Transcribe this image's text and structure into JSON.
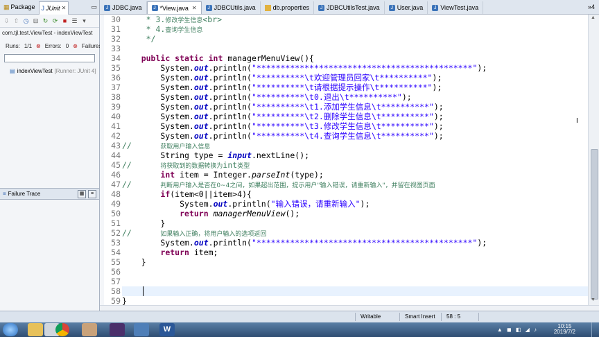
{
  "left_panel": {
    "tabs": [
      {
        "label": "Package",
        "icon": "package-icon"
      },
      {
        "label": "JUnit",
        "icon": "junit-icon"
      }
    ],
    "toolbar_icons": [
      "down-arrow-icon",
      "up-arrow-icon",
      "history-icon",
      "lock-icon",
      "rerun-icon",
      "rerun-failed-icon",
      "stop-icon",
      "layout-icon",
      "chevron-down-icon"
    ],
    "run_line": "com.tjl.test.ViewTest - indexViewTest",
    "runs_label": "Runs:",
    "runs_value": "1/1",
    "errors_label": "Errors:",
    "errors_value": "0",
    "failures_label": "Failures:",
    "failures_value": "0",
    "progress_color": "#ffffff",
    "tree_item_name": "indexViewTest",
    "tree_item_runner": "[Runner: JUnit 4]",
    "failure_trace_label": "Failure Trace"
  },
  "editor": {
    "tabs": [
      {
        "label": "JDBC.java",
        "icon": "java-file-icon",
        "active": false
      },
      {
        "label": "*View.java",
        "icon": "java-file-icon",
        "active": true
      },
      {
        "label": "JDBCUtils.java",
        "icon": "java-file-icon",
        "active": false
      },
      {
        "label": "db.properties",
        "icon": "properties-file-icon",
        "active": false
      },
      {
        "label": "JDBCUtilsTest.java",
        "icon": "java-file-icon",
        "active": false
      },
      {
        "label": "User.java",
        "icon": "java-file-icon",
        "active": false
      },
      {
        "label": "ViewTest.java",
        "icon": "java-file-icon",
        "active": false
      }
    ],
    "overflow": "»4",
    "cursor_line": 58,
    "lines": [
      {
        "n": "30",
        "parts": [
          [
            "cmt",
            "     * 3."
          ],
          [
            "cmt-cn",
            "修改学生信息"
          ],
          [
            "cmt",
            "<br>"
          ]
        ]
      },
      {
        "n": "31",
        "parts": [
          [
            "cmt",
            "     * 4."
          ],
          [
            "cmt-cn",
            "查询学生信息"
          ]
        ]
      },
      {
        "n": "32",
        "parts": [
          [
            "cmt",
            "     */"
          ]
        ]
      },
      {
        "n": "33",
        "parts": []
      },
      {
        "n": "34",
        "parts": [
          [
            "",
            "    "
          ],
          [
            "kw",
            "public static int"
          ],
          [
            "",
            " managerMenuView(){"
          ]
        ]
      },
      {
        "n": "35",
        "parts": [
          [
            "",
            "        System."
          ],
          [
            "fld",
            "out"
          ],
          [
            "",
            ".println("
          ],
          [
            "str",
            "\"*********************************************\""
          ],
          [
            "",
            ");"
          ]
        ]
      },
      {
        "n": "36",
        "parts": [
          [
            "",
            "        System."
          ],
          [
            "fld",
            "out"
          ],
          [
            "",
            ".println("
          ],
          [
            "str",
            "\"**********\\t"
          ],
          [
            "str",
            "欢迎管理员回家"
          ],
          [
            "str",
            "\\t**********\""
          ],
          [
            "",
            ");"
          ]
        ]
      },
      {
        "n": "37",
        "parts": [
          [
            "",
            "        System."
          ],
          [
            "fld",
            "out"
          ],
          [
            "",
            ".println("
          ],
          [
            "str",
            "\"**********\\t"
          ],
          [
            "str",
            "请根据提示操作"
          ],
          [
            "str",
            "\\t**********\""
          ],
          [
            "",
            ");"
          ]
        ]
      },
      {
        "n": "38",
        "parts": [
          [
            "",
            "        System."
          ],
          [
            "fld",
            "out"
          ],
          [
            "",
            ".println("
          ],
          [
            "str",
            "\"**********\\t0."
          ],
          [
            "str",
            "退出"
          ],
          [
            "str",
            "\\t**********\""
          ],
          [
            "",
            ");"
          ]
        ]
      },
      {
        "n": "39",
        "parts": [
          [
            "",
            "        System."
          ],
          [
            "fld",
            "out"
          ],
          [
            "",
            ".println("
          ],
          [
            "str",
            "\"**********\\t1."
          ],
          [
            "str",
            "添加学生信息"
          ],
          [
            "str",
            "\\t**********\""
          ],
          [
            "",
            ");"
          ]
        ]
      },
      {
        "n": "40",
        "parts": [
          [
            "",
            "        System."
          ],
          [
            "fld",
            "out"
          ],
          [
            "",
            ".println("
          ],
          [
            "str",
            "\"**********\\t2."
          ],
          [
            "str",
            "删除学生信息"
          ],
          [
            "str",
            "\\t**********\""
          ],
          [
            "",
            ");"
          ]
        ]
      },
      {
        "n": "41",
        "parts": [
          [
            "",
            "        System."
          ],
          [
            "fld",
            "out"
          ],
          [
            "",
            ".println("
          ],
          [
            "str",
            "\"**********\\t3."
          ],
          [
            "str",
            "修改学生信息"
          ],
          [
            "str",
            "\\t**********\""
          ],
          [
            "",
            ");"
          ]
        ]
      },
      {
        "n": "42",
        "parts": [
          [
            "",
            "        System."
          ],
          [
            "fld",
            "out"
          ],
          [
            "",
            ".println("
          ],
          [
            "str",
            "\"**********\\t4."
          ],
          [
            "str",
            "查询学生信息"
          ],
          [
            "str",
            "\\t**********\""
          ],
          [
            "",
            ");"
          ]
        ]
      },
      {
        "n": "43",
        "parts": [
          [
            "cmt",
            "//      "
          ],
          [
            "cmt-cn",
            "获取用户输入信息"
          ]
        ]
      },
      {
        "n": "44",
        "parts": [
          [
            "",
            "        String type = "
          ],
          [
            "fld",
            "input"
          ],
          [
            "",
            ".nextLine();"
          ]
        ]
      },
      {
        "n": "45",
        "parts": [
          [
            "cmt",
            "//      "
          ],
          [
            "cmt-cn",
            "将获取到的数据转换为"
          ],
          [
            "cmt",
            "int"
          ],
          [
            "cmt-cn",
            "类型"
          ]
        ]
      },
      {
        "n": "46",
        "parts": [
          [
            "",
            "        "
          ],
          [
            "kw",
            "int"
          ],
          [
            "",
            " item = Integer."
          ],
          [
            "ital",
            "parseInt"
          ],
          [
            "",
            "(type);"
          ]
        ]
      },
      {
        "n": "47",
        "parts": [
          [
            "cmt",
            "//      "
          ],
          [
            "cmt-cn",
            "判断用户输入是否在0~4之间，如果超出范围，提示用户\"输入错误，请重新输入\"，并留在视图页面"
          ]
        ]
      },
      {
        "n": "48",
        "parts": [
          [
            "",
            "        "
          ],
          [
            "kw",
            "if"
          ],
          [
            "",
            "(item<0||item>4){"
          ]
        ]
      },
      {
        "n": "49",
        "parts": [
          [
            "",
            "            System."
          ],
          [
            "fld",
            "out"
          ],
          [
            "",
            ".println("
          ],
          [
            "str",
            "\"输入错误，请重新输入\""
          ],
          [
            "",
            ");"
          ]
        ]
      },
      {
        "n": "50",
        "parts": [
          [
            "",
            "            "
          ],
          [
            "kw",
            "return"
          ],
          [
            "",
            " "
          ],
          [
            "ital",
            "managerMenuView"
          ],
          [
            "",
            "();"
          ]
        ]
      },
      {
        "n": "51",
        "parts": [
          [
            "",
            "        }"
          ]
        ]
      },
      {
        "n": "52",
        "parts": [
          [
            "cmt",
            "//      "
          ],
          [
            "cmt-cn",
            "如果输入正确，将用户输入的选项返回"
          ]
        ]
      },
      {
        "n": "53",
        "parts": [
          [
            "",
            "        System."
          ],
          [
            "fld",
            "out"
          ],
          [
            "",
            ".println("
          ],
          [
            "str",
            "\"*********************************************\""
          ],
          [
            "",
            ");"
          ]
        ]
      },
      {
        "n": "54",
        "parts": [
          [
            "",
            "        "
          ],
          [
            "kw",
            "return"
          ],
          [
            "",
            " item;"
          ]
        ]
      },
      {
        "n": "55",
        "parts": [
          [
            "",
            "    }"
          ]
        ]
      },
      {
        "n": "56",
        "parts": []
      },
      {
        "n": "57",
        "parts": []
      },
      {
        "n": "58",
        "parts": []
      },
      {
        "n": "59",
        "parts": [
          [
            "",
            "}"
          ]
        ]
      }
    ]
  },
  "status_bar": {
    "mode": "Writable",
    "insert": "Smart Insert",
    "position": "58 : 5"
  },
  "taskbar": {
    "apps": [
      "start-orb-icon",
      "explorer-folder-icon",
      "media-player-icon",
      "chrome-icon",
      "user-avatar-icon",
      "eclipse-icon",
      "desktop-window-icon",
      "word-icon"
    ],
    "time": "10:15",
    "date": "2019/7/2"
  },
  "colors": {
    "keyword": "#7f0055",
    "string": "#2a00ff",
    "comment": "#3f7f5f",
    "field": "#0000c0",
    "current_line": "#e8f2fe"
  }
}
